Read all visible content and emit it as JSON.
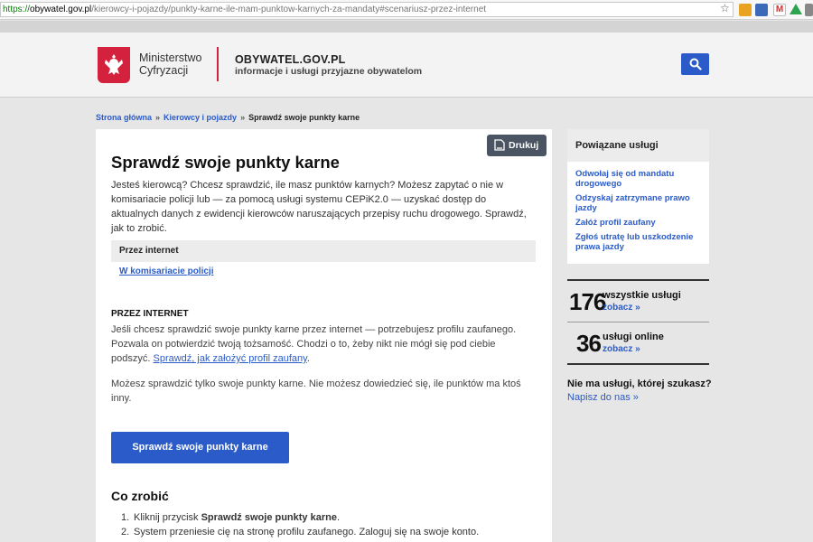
{
  "browser": {
    "url_scheme": "https://",
    "url_host": "obywatel.gov.pl",
    "url_path": "/kierowcy-i-pojazdy/punkty-karne-ile-mam-punktow-karnych-za-mandaty#scenariusz-przez-internet",
    "star_glyph": "☆",
    "gmail_glyph": "M"
  },
  "header": {
    "ministry_line1": "Ministerstwo",
    "ministry_line2": "Cyfryzacji",
    "site_name": "OBYWATEL.GOV.PL",
    "site_tagline": "informacje i usługi przyjazne obywatelom",
    "brand_color": "#d4213d",
    "accent_color": "#2a5bc8"
  },
  "breadcrumb": {
    "items": [
      "Strona główna",
      "Kierowcy i pojazdy"
    ],
    "separator": "»",
    "current": "Sprawdź swoje punkty karne"
  },
  "main": {
    "print_label": "Drukuj",
    "title": "Sprawdź swoje punkty karne",
    "intro": "Jesteś kierowcą? Chcesz sprawdzić, ile masz punktów karnych? Możesz zapytać o nie w komisariacie policji lub — za pomocą usługi systemu CEPiK2.0 — uzyskać dostęp do aktualnych danych z ewidencji kierowców naruszających przepisy ruchu drogowego. Sprawdź, jak to zrobić.",
    "tabs": {
      "active": "Przez internet",
      "other": "W komisariacie policji"
    },
    "section_heading": "PRZEZ INTERNET",
    "section_text": "Jeśli chcesz sprawdzić swoje punkty karne przez internet — potrzebujesz profilu zaufanego. Pozwala on potwierdzić twoją tożsamość. Chodzi o to, żeby nikt nie mógł się pod ciebie podszyć.",
    "section_link": "Sprawdź, jak założyć profil zaufany",
    "section_link_suffix": ".",
    "section_note": "Możesz sprawdzić tylko swoje punkty karne. Nie możesz dowiedzieć się, ile punktów ma ktoś inny.",
    "cta_label": "Sprawdź swoje punkty karne",
    "todo_heading": "Co zrobić",
    "steps": [
      {
        "num": "1.",
        "prefix": "Kliknij przycisk ",
        "bold": "Sprawdź swoje punkty karne",
        "suffix": "."
      },
      {
        "num": "2.",
        "prefix": "System przeniesie cię na stronę profilu zaufanego. Zaloguj się na swoje konto.",
        "bold": "",
        "suffix": ""
      }
    ]
  },
  "sidebar": {
    "related_title": "Powiązane usługi",
    "related_links": [
      "Odwołaj się od mandatu drogowego",
      "Odzyskaj zatrzymane prawo jazdy",
      "Załóż profil zaufany",
      "Zgłoś utratę lub uszkodzenie prawa jazdy"
    ],
    "stats": [
      {
        "count": "176",
        "label": "wszystkie usługi",
        "link": "zobacz »"
      },
      {
        "count": "36",
        "label": "usługi online",
        "link": "zobacz »"
      }
    ],
    "missing_text": "Nie ma usługi, której szukasz?",
    "missing_link": "Napisz do nas »"
  }
}
